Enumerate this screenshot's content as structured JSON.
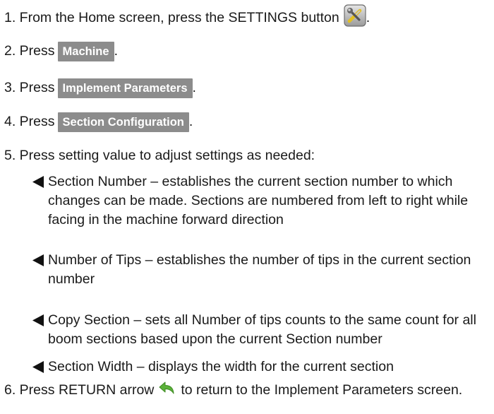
{
  "steps": {
    "s1_text": "1. From the Home screen, press the SETTINGS button",
    "s1_end": ".",
    "s1_icon": "settings-tools-icon",
    "s2_text": "2. Press",
    "s2_button": "Machine",
    "s2_end": ".",
    "s3_text": "3. Press",
    "s3_button": "Implement Parameters",
    "s3_end": ".",
    "s4_text": "4. Press",
    "s4_button": "Section Configuration",
    "s4_end": ".",
    "s5_text": "5. Press setting value to adjust settings as needed:",
    "s6_text_a": "6. Press RETURN arrow",
    "s6_icon": "return-arrow-icon",
    "s6_text_b": "to return to the Implement Parameters screen."
  },
  "bullets": [
    "Section Number – establishes the current section number to which changes can be made. Sections are numbered from left to right while facing in the machine forward direction",
    "Number of Tips – establishes the number of tips in the current section number",
    "Copy Section – sets all Number of tips counts to the same count for all boom sections based upon the current Section number",
    "Section Width – displays the width for the current section"
  ],
  "colors": {
    "button_bg": "#8c8c8c",
    "return_arrow": "#5bb13a"
  }
}
